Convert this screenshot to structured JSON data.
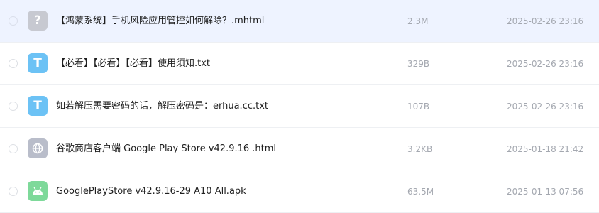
{
  "files": [
    {
      "name": "【鸿蒙系统】手机风险应用管控如何解除？.mhtml",
      "size": "2.3M",
      "date": "2025-02-26 23:16",
      "icon": "unknown-file-icon",
      "icon_glyph": "?",
      "icon_color": "#c7c9d1",
      "selected": true
    },
    {
      "name": "【必看】【必看】【必看】使用须知.txt",
      "size": "329B",
      "date": "2025-02-26 23:16",
      "icon": "text-file-icon",
      "icon_glyph": "T",
      "icon_color": "#6cc2f5",
      "selected": false
    },
    {
      "name": "如若解压需要密码的话，解压密码是：erhua.cc.txt",
      "size": "107B",
      "date": "2025-02-26 23:16",
      "icon": "text-file-icon",
      "icon_glyph": "T",
      "icon_color": "#6cc2f5",
      "selected": false
    },
    {
      "name": "谷歌商店客户端 Google Play Store v42.9.16 .html",
      "size": "3.2KB",
      "date": "2025-01-18 21:42",
      "icon": "web-file-icon",
      "icon_glyph": "",
      "icon_color": "#b9bdca",
      "selected": false
    },
    {
      "name": "GooglePlayStore v42.9.16-29 A10 All.apk",
      "size": "63.5M",
      "date": "2025-01-13 07:56",
      "icon": "android-apk-icon",
      "icon_glyph": "",
      "icon_color": "#7ed99a",
      "selected": false
    }
  ]
}
